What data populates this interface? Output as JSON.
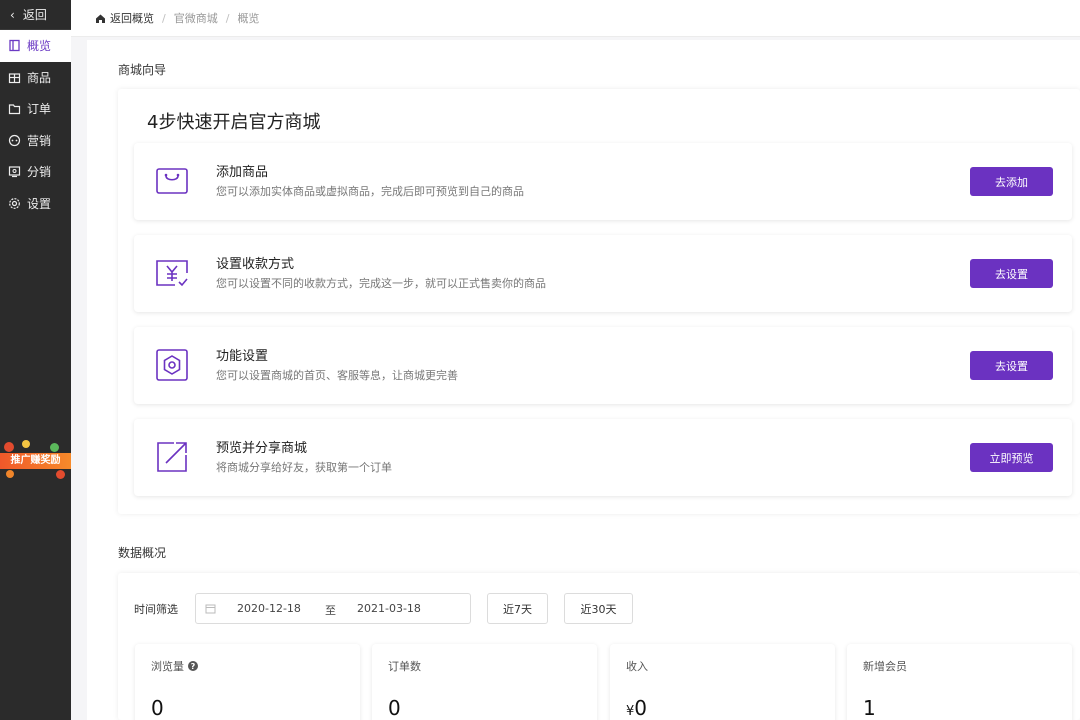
{
  "sidebar": {
    "back_label": "返回",
    "items": [
      {
        "label": "概览",
        "icon": "overview-icon",
        "active": true
      },
      {
        "label": "商品",
        "icon": "goods-icon",
        "active": false
      },
      {
        "label": "订单",
        "icon": "order-icon",
        "active": false
      },
      {
        "label": "营销",
        "icon": "marketing-icon",
        "active": false
      },
      {
        "label": "分销",
        "icon": "distribution-icon",
        "active": false
      },
      {
        "label": "设置",
        "icon": "settings-icon",
        "active": false
      }
    ],
    "promo_text": "推广赚奖励"
  },
  "breadcrumb": {
    "home": "返回概览",
    "items": [
      "官微商城",
      "概览"
    ]
  },
  "guide": {
    "section_title": "商城向导",
    "heading": "4步快速开启官方商城",
    "steps": [
      {
        "title": "添加商品",
        "desc": "您可以添加实体商品或虚拟商品，完成后即可预览到自己的商品",
        "button": "去添加",
        "icon": "shopping-bag-icon"
      },
      {
        "title": "设置收款方式",
        "desc": "您可以设置不同的收款方式，完成这一步，就可以正式售卖你的商品",
        "button": "去设置",
        "icon": "payment-yuan-icon"
      },
      {
        "title": "功能设置",
        "desc": "您可以设置商城的首页、客服等息，让商城更完善",
        "button": "去设置",
        "icon": "hexagon-settings-icon"
      },
      {
        "title": "预览并分享商城",
        "desc": "将商城分享给好友，获取第一个订单",
        "button": "立即预览",
        "icon": "share-arrow-icon"
      }
    ]
  },
  "data_overview": {
    "section_title": "数据概况",
    "filter_label": "时间筛选",
    "date_start": "2020-12-18",
    "date_to": "至",
    "date_end": "2021-03-18",
    "quick_7": "近7天",
    "quick_30": "近30天",
    "stats": [
      {
        "label": "浏览量",
        "value": "0",
        "currency": "",
        "help": true
      },
      {
        "label": "订单数",
        "value": "0",
        "currency": "",
        "help": false
      },
      {
        "label": "收入",
        "value": "0",
        "currency": "¥",
        "help": false
      },
      {
        "label": "新增会员",
        "value": "1",
        "currency": "",
        "help": false
      }
    ]
  },
  "colors": {
    "accent": "#6b32c1",
    "sidebar_bg": "#2b2b2b",
    "active_text": "#6b3ac4"
  }
}
